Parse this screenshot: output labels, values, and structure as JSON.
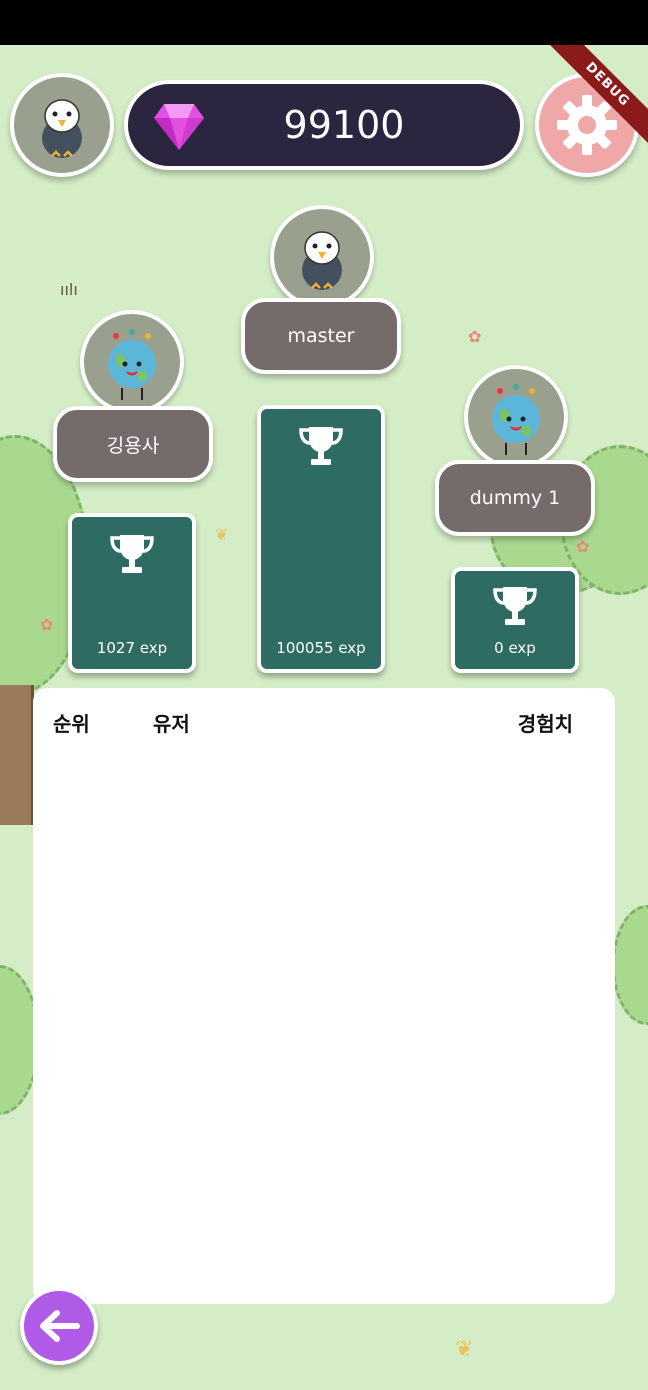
{
  "gems": {
    "value": "99100",
    "icon": "gem-icon",
    "color": "#e34fe0"
  },
  "debug_banner": "DEBUG",
  "podium": {
    "first": {
      "name": "master",
      "exp": "100055 exp",
      "avatar": "eagle-avatar"
    },
    "second": {
      "name": "깅용사",
      "exp": "1027 exp",
      "avatar": "earth-avatar"
    },
    "third": {
      "name": "dummy 1",
      "exp": "0 exp",
      "avatar": "earth-avatar"
    }
  },
  "ranking_table": {
    "headers": {
      "rank": "순위",
      "user": "유저",
      "exp": "경험치"
    },
    "rows": []
  },
  "colors": {
    "podium": "#2e6c63",
    "name_pill": "#766b6b",
    "gem_bar": "#2b2540",
    "settings": "#f0a7a8",
    "back": "#b05ae8"
  }
}
